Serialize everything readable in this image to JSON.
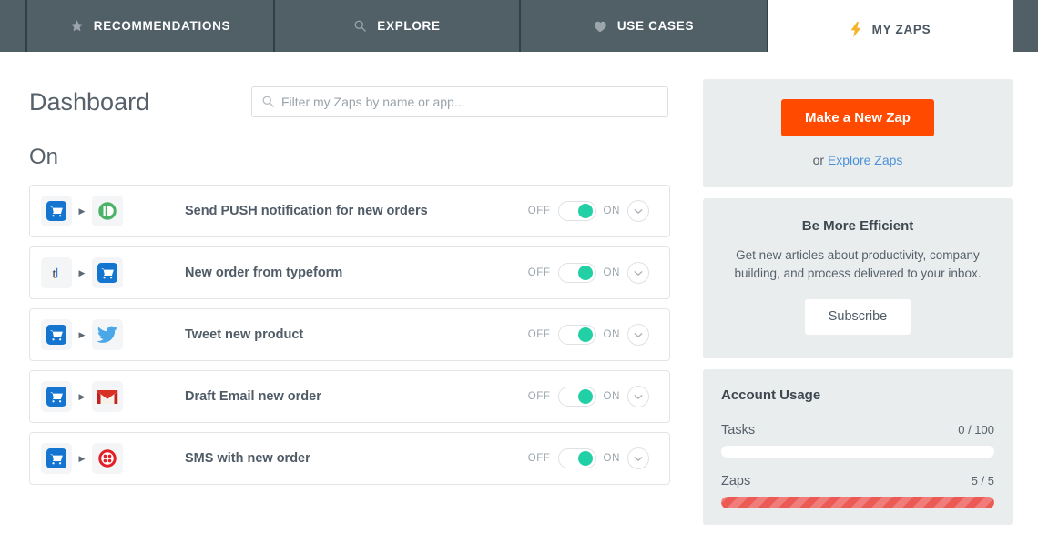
{
  "nav": {
    "tabs": [
      {
        "label": "RECOMMENDATIONS",
        "icon": "star-icon",
        "active": false
      },
      {
        "label": "EXPLORE",
        "icon": "search-icon",
        "active": false
      },
      {
        "label": "USE CASES",
        "icon": "heart-icon",
        "active": false
      },
      {
        "label": "MY ZAPS",
        "icon": "lightning-bolt-icon",
        "active": true
      }
    ]
  },
  "header": {
    "title": "Dashboard"
  },
  "search": {
    "placeholder": "Filter my Zaps by name or app...",
    "value": "",
    "icon": "search-icon"
  },
  "main": {
    "section_title": "On",
    "zaps": [
      {
        "name": "Send PUSH notification for new orders",
        "trigger_app": "shopping-cart-icon",
        "action_app": "pushbullet-icon",
        "off_label": "OFF",
        "on_label": "ON",
        "state": "on"
      },
      {
        "name": "New order from typeform",
        "trigger_app": "typeform-icon",
        "action_app": "shopping-cart-icon",
        "off_label": "OFF",
        "on_label": "ON",
        "state": "on"
      },
      {
        "name": "Tweet new product",
        "trigger_app": "shopping-cart-icon",
        "action_app": "twitter-icon",
        "off_label": "OFF",
        "on_label": "ON",
        "state": "on"
      },
      {
        "name": "Draft Email new order",
        "trigger_app": "shopping-cart-icon",
        "action_app": "gmail-icon",
        "off_label": "OFF",
        "on_label": "ON",
        "state": "on"
      },
      {
        "name": "SMS with new order",
        "trigger_app": "shopping-cart-icon",
        "action_app": "twilio-icon",
        "off_label": "OFF",
        "on_label": "ON",
        "state": "on"
      }
    ]
  },
  "sidebar": {
    "new_zap": {
      "button_label": "Make a New Zap",
      "or_text": "or ",
      "link_label": "Explore Zaps"
    },
    "efficient": {
      "title": "Be More Efficient",
      "body": "Get new articles about productivity, company building, and process delivered to your inbox.",
      "button_label": "Subscribe"
    },
    "usage": {
      "title": "Account Usage",
      "items": [
        {
          "label": "Tasks",
          "value": "0 / 100",
          "percent": 0,
          "style": "empty"
        },
        {
          "label": "Zaps",
          "value": "5 / 5",
          "percent": 100,
          "style": "full"
        }
      ]
    }
  },
  "colors": {
    "tab_bar": "#515f67",
    "accent_orange": "#ff4a00",
    "toggle_green": "#21d0a5",
    "link_blue": "#4a90d9",
    "usage_red": "#eb5a55",
    "card_gray": "#e9edee"
  }
}
